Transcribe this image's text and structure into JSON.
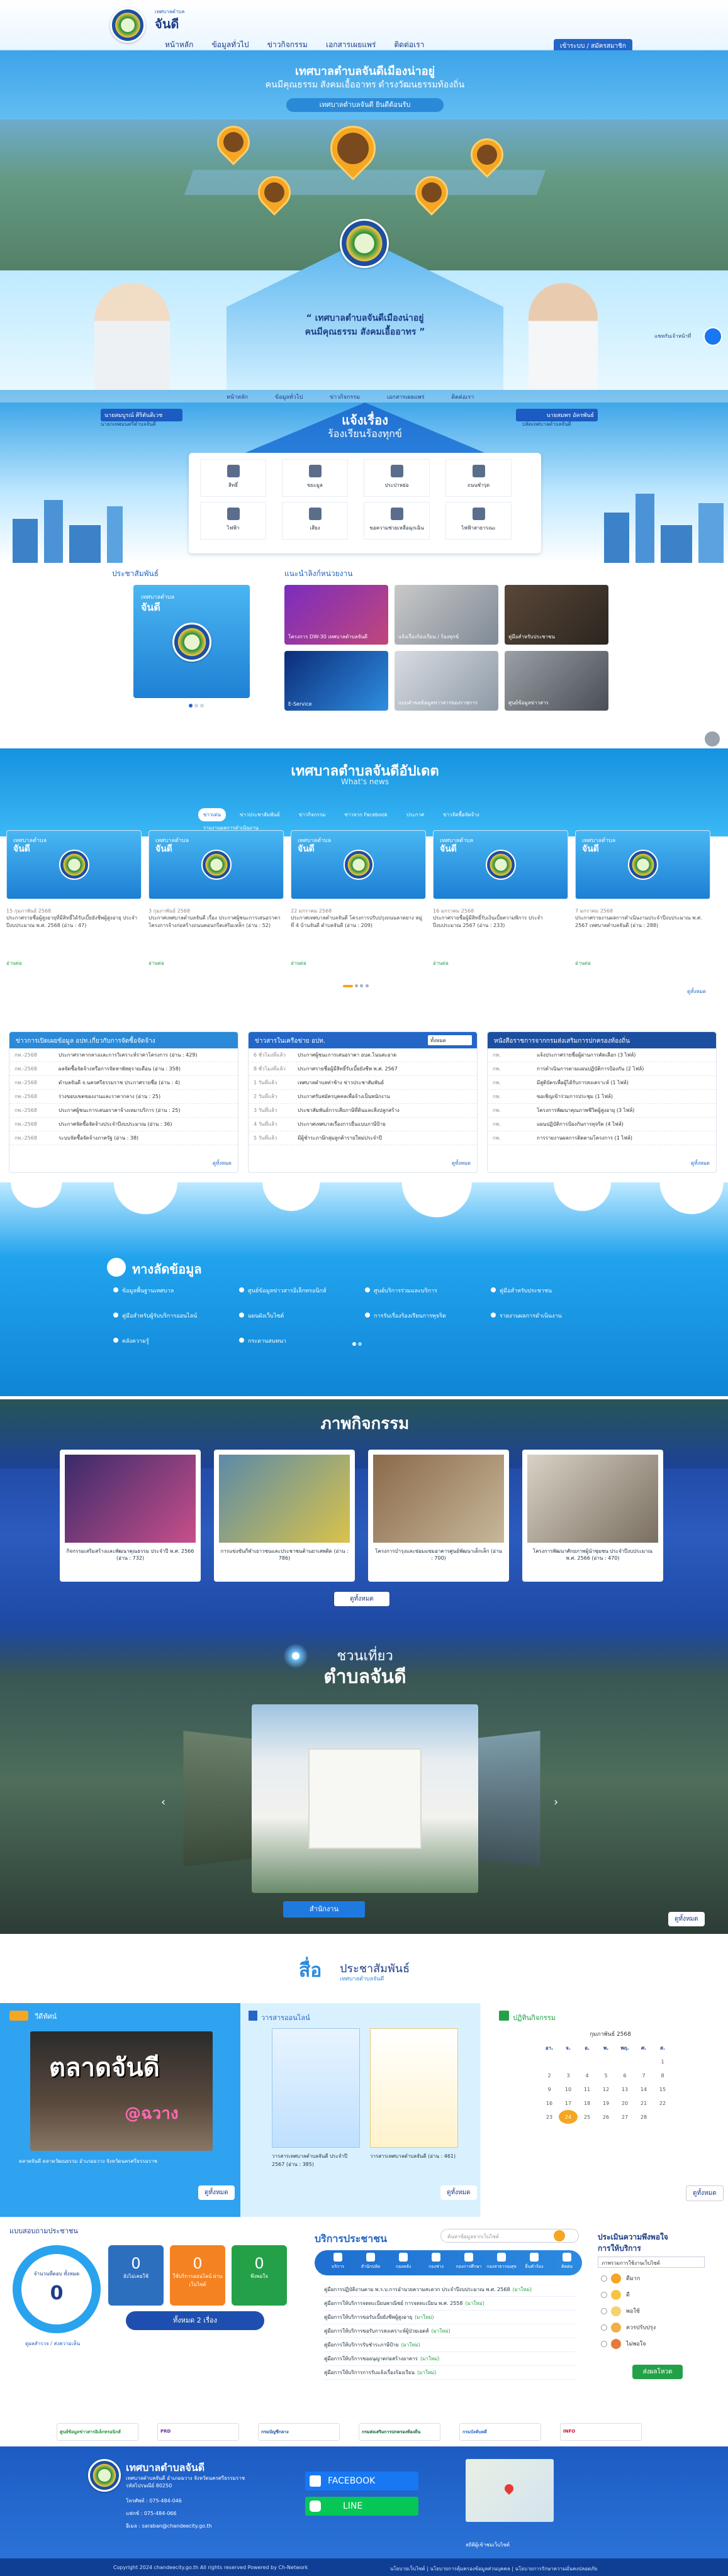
{
  "header": {
    "site_small": "เทศบาลตำบล",
    "site_name": "จันดี",
    "nav": [
      "หน้าหลัก",
      "ข้อมูลทั่วไป",
      "ข่าวกิจกรรม",
      "เอกสารเผยแพร่",
      "ติดต่อเรา"
    ],
    "login": "เข้าระบบ / สมัครสมาชิก"
  },
  "hero": {
    "title1": "เทศบาลตำบลจันดีเมืองน่าอยู่",
    "title2": "คนมีคุณธรรม สังคมเอื้ออาทร ดำรงวัฒนธรรมท้องถิ่น",
    "ribbon": "เทศบาลตำบลจันดี ยินดีต้อนรับ",
    "quote1": "“ เทศบาลตำบลจันดีเมืองน่าอยู่",
    "quote2": "คนมีคุณธรรม สังคมเอื้ออาทร ”",
    "left_name": "นายสมบูรณ์ ศิริตันติเวช",
    "left_role": "นายกเทศมนตรีตำบลจันดี",
    "right_name": "นายสมพร อัครพันธ์",
    "right_role": "ปลัดเทศบาลตำบลจันดี",
    "messenger": "แชทกับเจ้าหน้าที่"
  },
  "complaint": {
    "title": "แจ้งเรื่อง",
    "subtitle": "ร้องเรียนร้องทุกข์",
    "items": [
      "สิทธิ์",
      "ขยะมูล",
      "ประปาหย่อ",
      "ถนนชำรุด",
      "ไฟฟ้า",
      "เสียง",
      "ขอความช่วยเหลือฉุกเฉิน",
      "ไฟฟ้าสาธารณะ"
    ]
  },
  "pr": {
    "title": "ประชาสัมพันธ์",
    "link_title": "แนะนำลิงก์หน่วยงาน",
    "tiles": [
      "โครงการ DW-30 เทศบาลตำบลจันดี",
      "แจ้งเรื่องร้องเรียน / ร้องทุกข์",
      "คู่มือสำหรับประชาชน",
      "E-Service",
      "แบบคำขอข้อมูลข่าวสารของราชการ",
      "ศูนย์ข้อมูลข่าวสาร"
    ]
  },
  "news": {
    "title": "เทศบาลตำบลจันดีอัปเดต",
    "subtitle": "What's news",
    "tabs": [
      "ข่าวเด่น",
      "ข่าวประชาสัมพันธ์",
      "ข่าวกิจกรรม",
      "ข่าวจาก Facebook",
      "ประกาศ",
      "ข่าวจัดซื้อจัดจ้าง",
      "รายงานผลการดำเนินงาน"
    ],
    "cards": [
      {
        "date": "15 กุมภาพันธ์ 2568",
        "text": "ประกาศรายชื่อผู้สูงอายุที่มีสิทธิ์ได้รับเบี้ยยังชีพผู้สูงอายุ ประจำปีงบประมาณ พ.ศ. 2568 (อ่าน : 47)"
      },
      {
        "date": "3 กุมภาพันธ์ 2568",
        "text": "ประกาศเทศบาลตำบลจันดี เรื่อง ประกาศผู้ชนะการเสนอราคา โครงการจ้างก่อสร้างถนนคอนกรีตเสริมเหล็ก (อ่าน : 52)"
      },
      {
        "date": "22 มกราคม 2568",
        "text": "ประกาศเทศบาลตำบลจันดี โครงการปรับปรุงถนนลาดยาง หมู่ที่ 4 บ้านจันดี ตำบลจันดี (อ่าน : 209)"
      },
      {
        "date": "16 มกราคม 2568",
        "text": "ประกาศรายชื่อผู้มีสิทธิ์รับเงินเบี้ยความพิการ ประจำปีงบประมาณ 2567 (อ่าน : 233)"
      },
      {
        "date": "7 มกราคม 2568",
        "text": "ประกาศรายงานผลการดำเนินงานประจำปีงบประมาณ พ.ศ. 2567 เทศบาลตำบลจันดี (อ่าน : 288)"
      }
    ],
    "more": "ดูทั้งหมด",
    "read_more": "อ่านต่อ"
  },
  "panels": [
    {
      "title": "ข่าวการเปิดเผยข้อมูล อปท.เกี่ยวกับการจัดซื้อจัดจ้าง",
      "rows": [
        [
          "กพ.-2568",
          "ประกาศราคากลางและการวิเคราะห์ราคาโครงการ (อ่าน : 429)"
        ],
        [
          "กพ.-2568",
          "ผลจัดซื้อจัดจ้างหรือการจัดหาพัสดุรายเดือน (อ่าน : 358)"
        ],
        [
          "กพ.-2568",
          "ตำบลจันดี จ.นครศรีธรรมราช ประกาศรายชื่อ (อ่าน : 4)"
        ],
        [
          "กพ.-2568",
          "ร่างขอบเขตของงานและราคากลาง (อ่าน : 25)"
        ],
        [
          "กพ.-2568",
          "ประกาศผู้ชนะการเสนอราคาจ้างเหมาบริการ (อ่าน : 25)"
        ],
        [
          "กพ.-2568",
          "ประกาศจัดซื้อจัดจ้างประจำปีงบประมาณ (อ่าน : 36)"
        ],
        [
          "กพ.-2568",
          "ระบบจัดซื้อจัดจ้างภาครัฐ (อ่าน : 38)"
        ]
      ]
    },
    {
      "title": "ข่าวสารในเครือข่าย อปท.",
      "rows": [
        [
          "6 ชั่วโมงที่แล้ว",
          "ประกาศผู้ชนะการเสนอราคา อบต.โนนสะอาด"
        ],
        [
          "8 ชั่วโมงที่แล้ว",
          "ประกาศรายชื่อผู้มีสิทธิ์รับเบี้ยยังชีพ พ.ศ. 2567"
        ],
        [
          "1 วันที่แล้ว",
          "เทศบาลตำบลท่าช้าง ข่าวประชาสัมพันธ์"
        ],
        [
          "2 วันที่แล้ว",
          "ประกาศรับสมัครบุคคลเพื่อจ้างเป็นพนักงาน"
        ],
        [
          "3 วันที่แล้ว",
          "ประชาสัมพันธ์การเสียภาษีที่ดินและสิ่งปลูกสร้าง"
        ],
        [
          "4 วันที่แล้ว",
          "ประกาศเทศบาลเรื่องการยื่นแบบภาษีป้าย"
        ],
        [
          "5 วันที่แล้ว",
          "มีผู้ชำระภาษีกลุ่มลูกค้ารายใหม่ประจำปี"
        ]
      ]
    },
    {
      "title": "หนังสือราชการจากกรมส่งเสริมการปกครองท้องถิ่น",
      "rows": [
        [
          "กพ.",
          "แจ้งประกาศรายชื่อผู้ผ่านการคัดเลือก (3 ไฟล์)"
        ],
        [
          "กพ.",
          "การดำเนินการตามแผนปฏิบัติการป้องกัน (2 ไฟล์)"
        ],
        [
          "กพ.",
          "มีสูติบัตรเพื่อผู้ได้รับการสงเคราะห์ (1 ไฟล์)"
        ],
        [
          "กพ.",
          "ขอเชิญเข้าร่วมการประชุม (1 ไฟล์)"
        ],
        [
          "กพ.",
          "โครงการพัฒนาคุณภาพชีวิตผู้สูงอายุ (3 ไฟล์)"
        ],
        [
          "กพ.",
          "แผนปฏิบัติการป้องกันการทุจริต (4 ไฟล์)"
        ],
        [
          "กพ.",
          "การรายงานผลการติดตามโครงการ (1 ไฟล์)"
        ]
      ]
    }
  ],
  "panel2_select": "ทั้งหมด",
  "info": {
    "title": "ทางลัดข้อมูล",
    "links": [
      "ข้อมูลพื้นฐานเทศบาล",
      "ศูนย์ข้อมูลข่าวสารอิเล็กทรอนิกส์",
      "ศูนย์บริการร่วมและบริการ",
      "คู่มือสำหรับประชาชน",
      "คู่มือสำหรับผู้รับบริการออนไลน์",
      "แผนผังเว็บไซต์",
      "การรับเรื่องร้องเรียนการทุจริต",
      "รายงานผลการดำเนินงาน",
      "คลังความรู้",
      "กระดานสนทนา"
    ]
  },
  "activity": {
    "title": "ภาพกิจกรรม",
    "cards": [
      {
        "caption": "กิจกรรมเสริมสร้างและพัฒนาคุณธรรม ประจำปี พ.ศ. 2566",
        "reads": "(อ่าน : 732)"
      },
      {
        "caption": "การแข่งขันกีฬาเยาวชนและประชาชนต้านยาเสพติด",
        "reads": "(อ่าน : 786)"
      },
      {
        "caption": "โครงการบำรุงและซ่อมแซมอาคารศูนย์พัฒนาเด็กเล็ก",
        "reads": "(อ่าน : 700)"
      },
      {
        "caption": "โครงการพัฒนาศักยภาพผู้นำชุมชน ประจำปีงบประมาณ พ.ศ. 2566",
        "reads": "(อ่าน : 470)"
      }
    ],
    "more": "ดูทั้งหมด"
  },
  "tour": {
    "title1": "ชวนเที่ยว",
    "title2": "ตำบลจันดี",
    "button": "สำนักงาน",
    "more": "ดูทั้งหมด"
  },
  "media": {
    "title": "สื่อ",
    "title2": "ประชาสัมพันธ์",
    "subtitle": "เทศบาลตำบลจันดี",
    "video_title": "วีดีทัศน์",
    "video_banner": "ตลาดจันดี",
    "video_sub": "@ฉวาง",
    "video_caption": "ตลาดจันดี ตลาดวัฒนธรรม อำเภอฉวาง จังหวัดนครศรีธรรมราช",
    "journal_title": "วารสารออนไลน์",
    "journal_items": [
      {
        "caption": "วารสารเทศบาลตำบลจันดี ประจำปี 2567",
        "reads": "(อ่าน : 385)"
      },
      {
        "caption": "วารสารเทศบาลตำบลจันดี",
        "reads": "(อ่าน : 461)"
      }
    ],
    "calendar_title": "ปฏิทินกิจกรรม",
    "calendar_month": "กุมภาพันธ์ 2568",
    "weekdays": [
      "อา.",
      "จ.",
      "อ.",
      "พ.",
      "พฤ.",
      "ศ.",
      "ส."
    ],
    "days": [
      "",
      "",
      "",
      "",
      "",
      "",
      "1",
      "2",
      "3",
      "4",
      "5",
      "6",
      "7",
      "8",
      "9",
      "10",
      "11",
      "12",
      "13",
      "14",
      "15",
      "16",
      "17",
      "18",
      "19",
      "20",
      "21",
      "22",
      "23",
      "24",
      "25",
      "26",
      "27",
      "28",
      ""
    ],
    "today": "24",
    "more": "ดูทั้งหมด"
  },
  "stats": {
    "title": "แบบสอบถามความคิดเห็น",
    "title_short": "แบบสอบถามประชาชน",
    "ring_label": "จำนวนที่ตอบ ทั้งหมด",
    "ring_value": "0",
    "ring_link": "ดูผลสำรวจ / ส่งความเห็น",
    "boxes": [
      {
        "value": "0",
        "label": "ยังไม่เคยใช้"
      },
      {
        "value": "0",
        "label": "ใช้บริการออนไลน์ ผ่านเว็บไซต์"
      },
      {
        "value": "0",
        "label": "พึงพอใจ"
      }
    ],
    "bar": "ทั้งหมด 2 เรื่อง"
  },
  "eservice": {
    "title": "บริการประชาชน",
    "search": "ค้นหาข้อมูลจากเว็บไซต์",
    "icons": [
      "บริการ",
      "สำนักปลัด",
      "กองคลัง",
      "กองช่าง",
      "กองการศึกษา",
      "กองสาธารณสุข",
      "ยื่นคำร้อง",
      "ติดต่อ"
    ],
    "rows": [
      "คู่มือการปฏิบัติงานตาม พ.ร.บ.การอำนวยความสะดวก ประจำปีงบประมาณ พ.ศ. 2568",
      "คู่มือการให้บริการจดทะเบียนพาณิชย์ การจดทะเบียน พ.ศ. 2558",
      "คู่มือการให้บริการขอรับเบี้ยยังชีพผู้สูงอายุ",
      "คู่มือการให้บริการขอรับการสงเคราะห์ผู้ป่วยเอดส์",
      "คู่มือการให้บริการรับชำระภาษีป้าย",
      "คู่มือการให้บริการขออนุญาตก่อสร้างอาคาร",
      "คู่มือการให้บริการการรับแจ้งเรื่องร้องเรียน"
    ],
    "new_tag": "(มาใหม่)"
  },
  "poll": {
    "title": "ประเมินความพึงพอใจ",
    "title2": "การให้บริการ",
    "select": "ภาพรวมการใช้งานเว็บไซต์",
    "options": [
      "ดีมาก",
      "ดี",
      "พอใช้",
      "ควรปรับปรุง",
      "ไม่พอใจ"
    ],
    "vote": "ส่งผลโหวต"
  },
  "partners": [
    "ศูนย์ข้อมูลข่าวสารอิเล็กทรอนิกส์",
    "PRD",
    "กรมบัญชีกลาง",
    "กรมส่งเสริมการปกครองท้องถิ่น",
    "กรมบังคับคดี",
    "INFO"
  ],
  "footer": {
    "name": "เทศบาลตำบลจันดี",
    "addr1": "เทศบาลตำบลจันดี อำเภอฉวาง จังหวัดนครศรีธรรมราช",
    "addr2": "รหัสไปรษณีย์ 80250",
    "tel": "โทรศัพท์ : 075-484-046",
    "fax": "แฟกซ์ : 075-484-066",
    "email": "อีเมล : saraban@chandeecity.go.th",
    "facebook": "FACEBOOK",
    "line": "LINE",
    "visit": "สถิติผู้เข้าชมเว็บไซต์",
    "copyright": "Copyright 2024 chandeecity.go.th All rights reserved Powered by Ch-Network",
    "links": "นโยบายเว็บไซต์ | นโยบายการคุ้มครองข้อมูลส่วนบุคคล | นโยบายการรักษาความมั่นคงปลอดภัย"
  },
  "colors": {
    "brand": "#2366c8",
    "accent": "#f5a623",
    "green": "#24a148"
  }
}
